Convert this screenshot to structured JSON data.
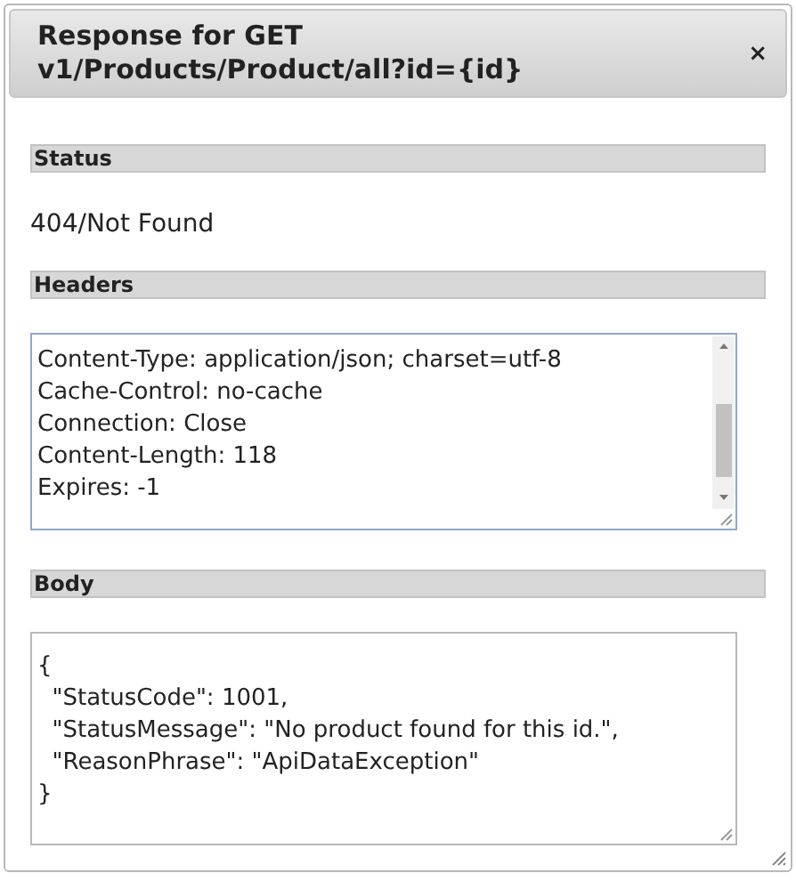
{
  "dialog": {
    "title": "Response for GET v1/Products/Product/all?id={id}",
    "close": "×"
  },
  "sections": [
    {
      "kind": "text",
      "heading": "Status",
      "value": "404/Not Found"
    },
    {
      "kind": "field",
      "heading": "Headers",
      "scrollable": true,
      "lines": [
        "Content-Type: application/json; charset=utf-8",
        "Cache-Control: no-cache",
        "Connection: Close",
        "Content-Length: 118",
        "Expires: -1"
      ]
    },
    {
      "kind": "field",
      "heading": "Body",
      "scrollable": false,
      "lines": [
        "{",
        "  \"StatusCode\": 1001,",
        "  \"StatusMessage\": \"No product found for this id.\",",
        "  \"ReasonPhrase\": \"ApiDataException\"",
        "}"
      ]
    }
  ]
}
